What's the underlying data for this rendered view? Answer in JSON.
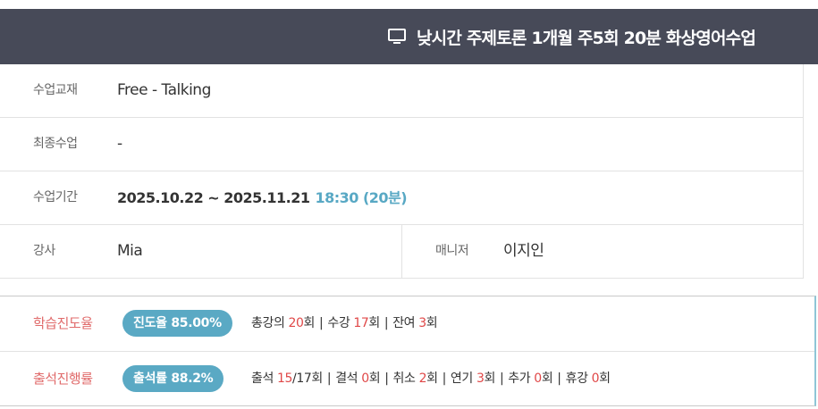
{
  "header": {
    "icon": "monitor-icon",
    "title": "낮시간 주제토론 1개월 주5회 20분 화상영어수업"
  },
  "info": {
    "textbook": {
      "label": "수업교재",
      "value": "Free - Talking"
    },
    "last_class": {
      "label": "최종수업",
      "value": "-"
    },
    "period": {
      "label": "수업기간",
      "value": "2025.10.22 ~ 2025.11.21",
      "time": "18:30 (20분)"
    },
    "teacher": {
      "label": "강사",
      "value": "Mia"
    },
    "manager": {
      "label": "매니저",
      "value": "이지인"
    }
  },
  "progress": {
    "learning": {
      "label": "학습진도율",
      "pill": "진도율 85.00%",
      "total_label": "총강의",
      "total_value": "20",
      "taken_label": "수강",
      "taken_value": "17",
      "remain_label": "잔여",
      "remain_value": "3",
      "unit": "회",
      "separator": "|"
    },
    "attendance": {
      "label": "출석진행률",
      "pill": "출석률 88.2%",
      "attend_label": "출석",
      "attend_value": "15",
      "attend_total": "/17회",
      "absent_label": "결석",
      "absent_value": "0",
      "cancel_label": "취소",
      "cancel_value": "2",
      "postpone_label": "연기",
      "postpone_value": "3",
      "extra_label": "추가",
      "extra_value": "0",
      "break_label": "휴강",
      "break_value": "0",
      "unit": "회",
      "separator": "|"
    }
  },
  "colors": {
    "header_bg": "#474a58",
    "accent_blue": "#5aa9c4",
    "label_red": "#e06a6a",
    "number_red": "#e04848"
  }
}
